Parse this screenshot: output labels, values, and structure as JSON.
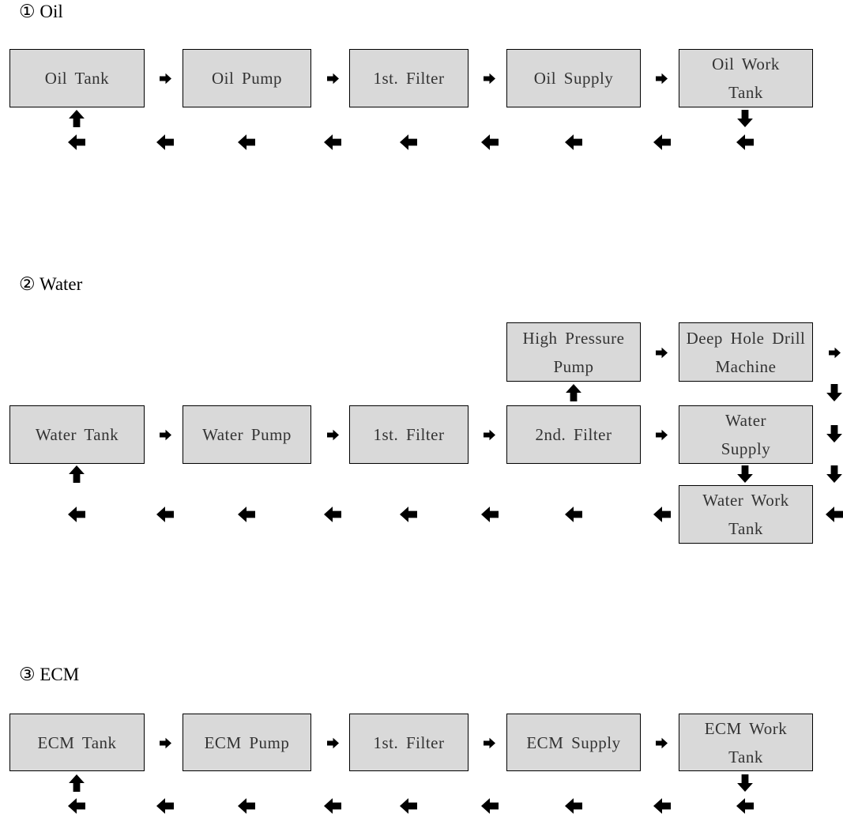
{
  "sections": [
    {
      "title": "① Oil",
      "boxes": [
        "Oil Tank",
        "Oil Pump",
        "1st. Filter",
        "Oil Supply",
        "Oil Work Tank"
      ]
    },
    {
      "title": "② Water",
      "boxes": [
        "Water Tank",
        "Water Pump",
        "1st. Filter",
        "2nd. Filter",
        "Water Supply",
        "High Pressure Pump",
        "Deep Hole Drill Machine",
        "Water Work Tank"
      ]
    },
    {
      "title": "③ ECM",
      "boxes": [
        "ECM Tank",
        "ECM Pump",
        "1st. Filter",
        "ECM Supply",
        "ECM Work Tank"
      ]
    }
  ],
  "colors": {
    "box_fill": "#d9d9d9",
    "arrow": "#000000"
  }
}
